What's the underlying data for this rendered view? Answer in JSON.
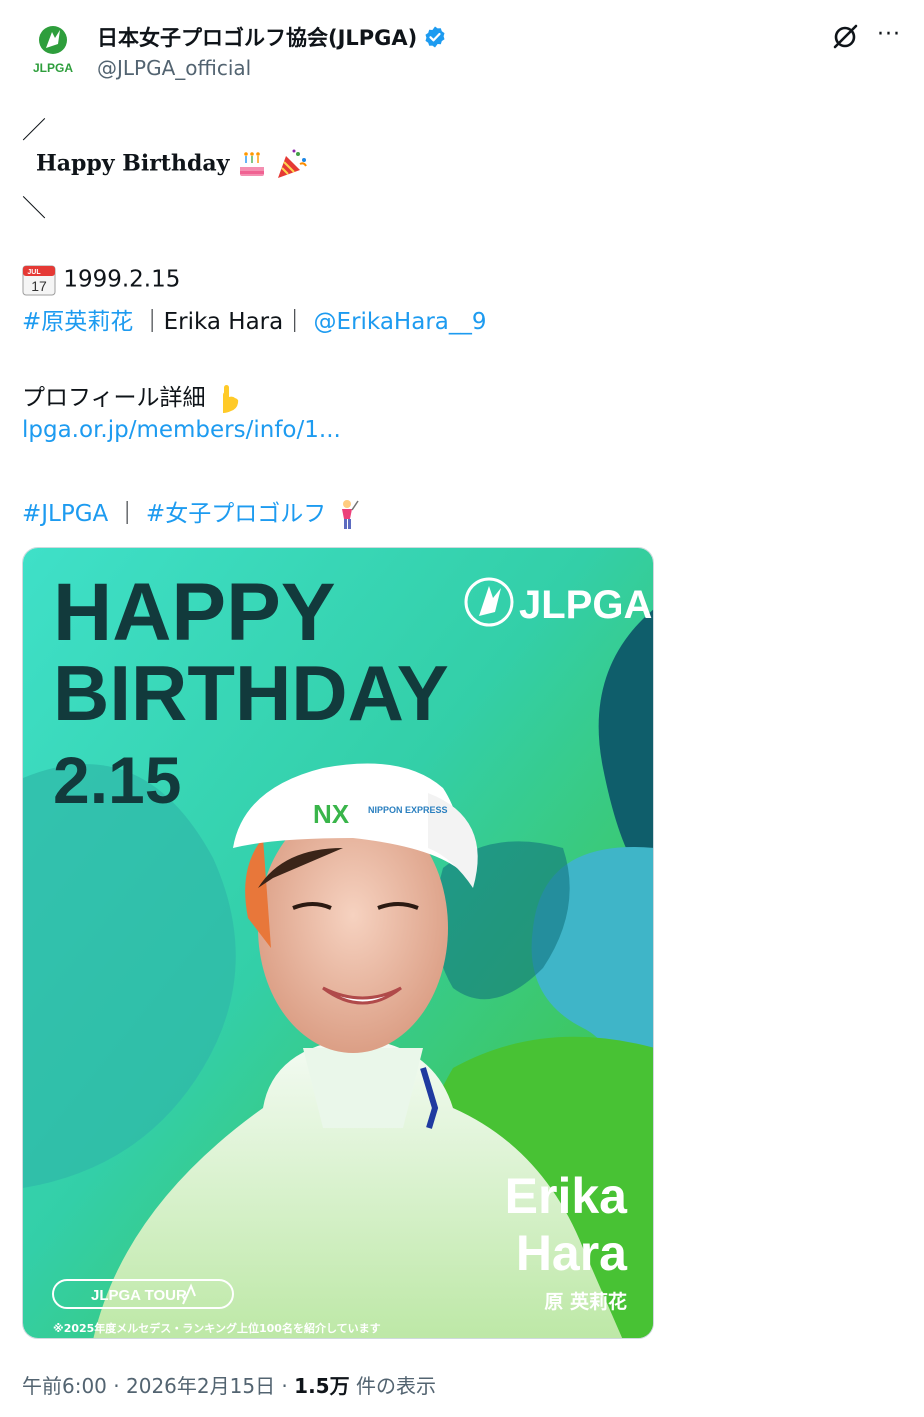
{
  "account": {
    "display_name": "日本女子プロゴルフ協会(JLPGA)",
    "handle": "@JLPGA_official",
    "avatar_text": "JLPGA",
    "verified_color": "#1d9bf0"
  },
  "post": {
    "deco_top": "／",
    "headline": "Happy Birthday",
    "deco_bottom": "＼",
    "date_line": "1999.2.15",
    "calendar_month": "JUL",
    "calendar_day": "17",
    "hashtag_name": "#原英莉花",
    "sep1": "｜Erika Hara｜",
    "mention": "@ErikaHara__9",
    "profile_label": "プロフィール詳細",
    "profile_link": "lpga.or.jp/members/info/1...",
    "tag1": "#JLPGA",
    "tag_sep": "｜",
    "tag2": "#女子プロゴルフ"
  },
  "media": {
    "line1": "HAPPY",
    "line2": "BIRTHDAY",
    "date": "2.15",
    "brand": "JLPGA",
    "name_en_1": "Erika",
    "name_en_2": "Hara",
    "name_jp": "原 英莉花",
    "tour_label": "JLPGA TOUR",
    "footnote": "※2025年度メルセデス・ランキング上位100名を紹介しています",
    "visor_text": "NX",
    "visor_sponsor": "NIPPON EXPRESS",
    "colors": {
      "dark_text": "#123a3c",
      "teal": "#3fd8c4",
      "green": "#4cc532",
      "deep_teal": "#0f5e6b"
    }
  },
  "meta": {
    "time": "午前6:00",
    "dot1": " · ",
    "date": "2026年2月15日",
    "dot2": " · ",
    "views": "1.5万",
    "views_label": " 件の表示"
  }
}
